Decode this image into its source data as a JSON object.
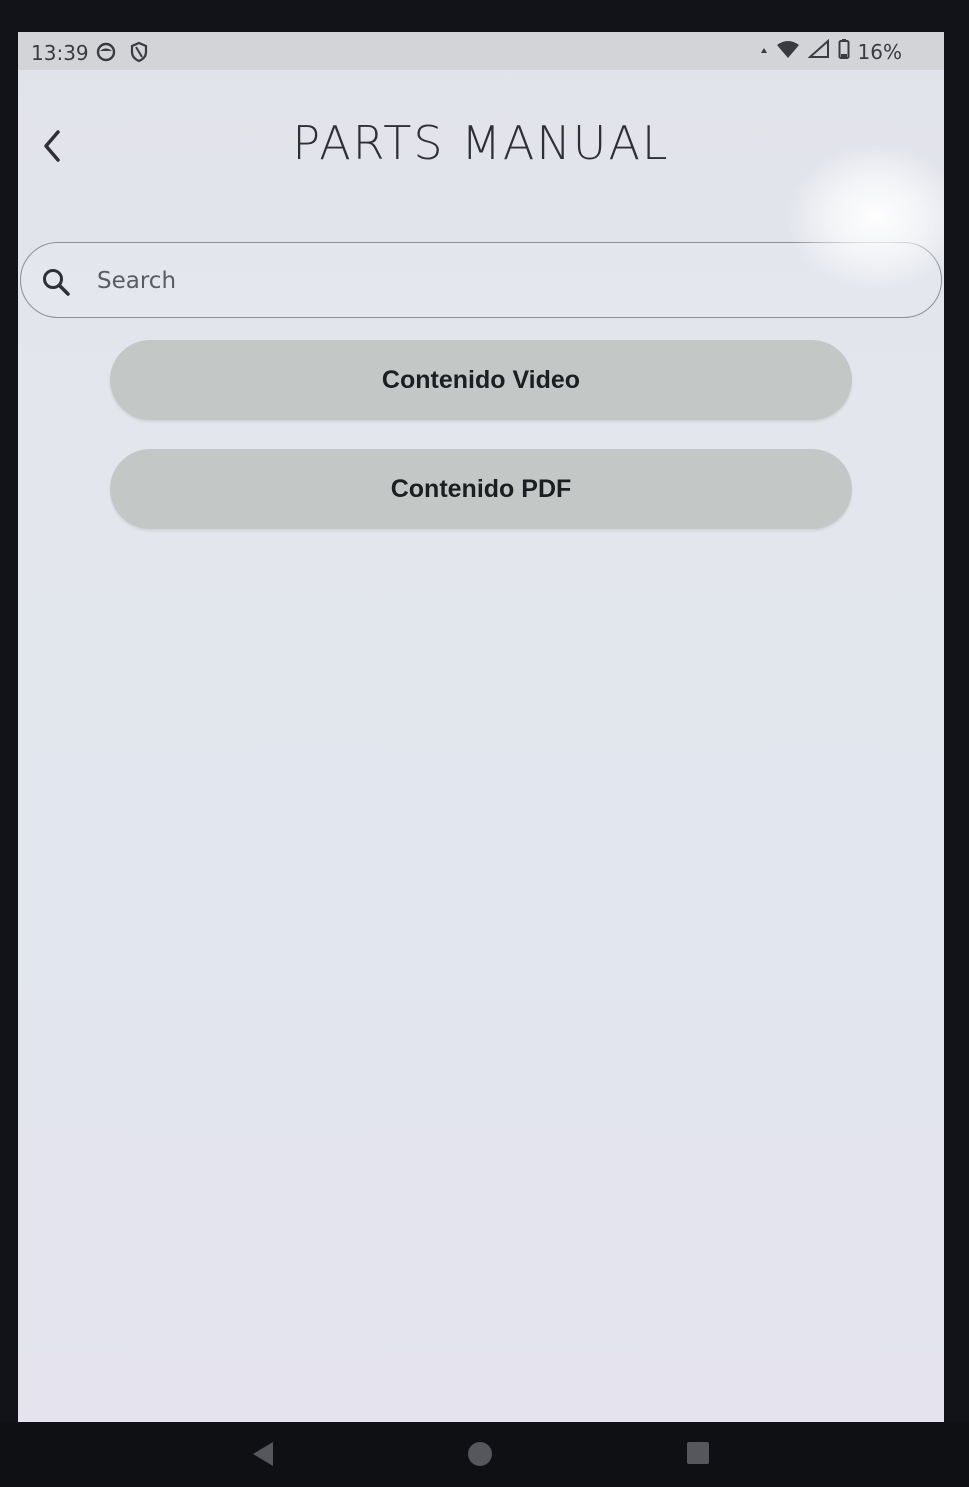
{
  "statusbar": {
    "time": "13:39",
    "battery": "16%",
    "icons": [
      "app-notification-icon",
      "shield-icon",
      "data-arrow-icon",
      "wifi-icon",
      "signal-icon",
      "battery-icon"
    ]
  },
  "header": {
    "title": "PARTS MANUAL",
    "back_icon": "chevron-left-icon"
  },
  "search": {
    "placeholder": "Search",
    "value": "",
    "icon": "search-icon"
  },
  "buttons": [
    {
      "label": "Contenido Video"
    },
    {
      "label": "Contenido PDF"
    }
  ],
  "navbar": {
    "icons": [
      "nav-back-icon",
      "nav-home-icon",
      "nav-recents-icon"
    ]
  },
  "colors": {
    "screen_background": "#e2e5ec",
    "statusbar_background": "#d3d4d8",
    "button_background": "#c3c8c6",
    "title_text": "#2f3036",
    "bezel": "#0f1014"
  }
}
